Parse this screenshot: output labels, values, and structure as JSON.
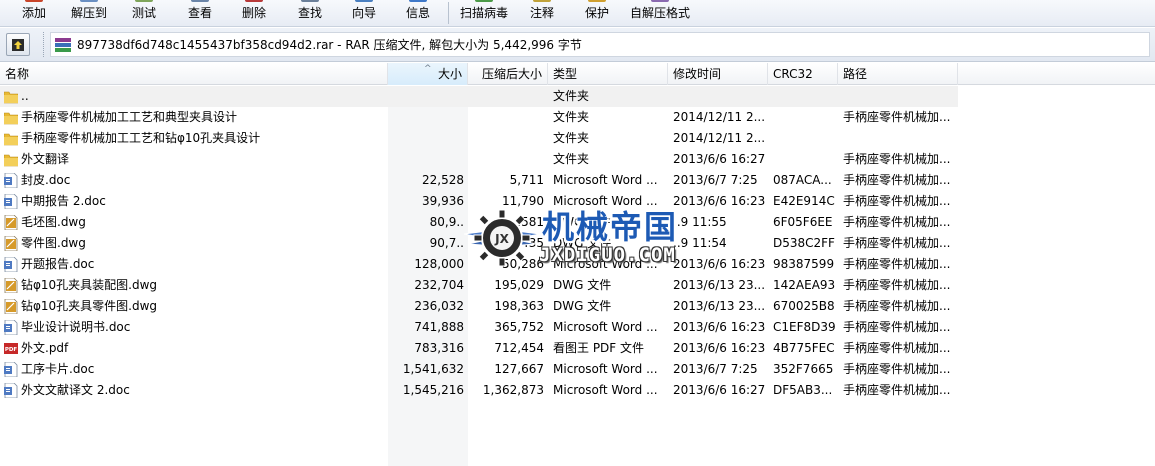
{
  "toolbar": {
    "buttons": [
      {
        "label": "添加",
        "icon": "add-icon",
        "color": "#c8452a"
      },
      {
        "label": "解压到",
        "icon": "extract-to-icon",
        "color": "#6a8fc2"
      },
      {
        "label": "测试",
        "icon": "test-icon",
        "color": "#7fa55a"
      },
      {
        "label": "查看",
        "icon": "view-icon",
        "color": "#6b85a8"
      },
      {
        "label": "删除",
        "icon": "delete-icon",
        "color": "#b83a3a"
      },
      {
        "label": "查找",
        "icon": "find-icon",
        "color": "#6b7f99"
      },
      {
        "label": "向导",
        "icon": "wizard-icon",
        "color": "#4a7fc0"
      },
      {
        "label": "信息",
        "icon": "info-icon",
        "color": "#3f78c8"
      },
      {
        "label": "扫描病毒",
        "icon": "virus-scan-icon",
        "color": "#4b9a48"
      },
      {
        "label": "注释",
        "icon": "comment-icon",
        "color": "#c0a23a"
      },
      {
        "label": "保护",
        "icon": "protect-icon",
        "color": "#d0a030"
      },
      {
        "label": "自解压格式",
        "icon": "sfx-icon",
        "color": "#8a6ab0"
      }
    ]
  },
  "address": {
    "text": "897738df6d748c1455437bf358cd94d2.rar - RAR 压缩文件, 解包大小为 5,442,996 字节"
  },
  "columns": {
    "name": "名称",
    "size": "大小",
    "packed": "压缩后大小",
    "type": "类型",
    "mtime": "修改时间",
    "crc": "CRC32",
    "path": "路径"
  },
  "files": [
    {
      "name": "..",
      "size": "",
      "packed": "",
      "type": "文件夹",
      "mtime": "",
      "crc": "",
      "path": "",
      "icon": "folder-icon"
    },
    {
      "name": "手柄座零件机械加工工艺和典型夹具设计",
      "size": "",
      "packed": "",
      "type": "文件夹",
      "mtime": "2014/12/11 2...",
      "crc": "",
      "path": "手柄座零件机械加...",
      "icon": "folder-icon"
    },
    {
      "name": "手柄座零件机械加工工艺和钻φ10孔夹具设计",
      "size": "",
      "packed": "",
      "type": "文件夹",
      "mtime": "2014/12/11 2...",
      "crc": "",
      "path": "",
      "icon": "folder-icon"
    },
    {
      "name": "外文翻译",
      "size": "",
      "packed": "",
      "type": "文件夹",
      "mtime": "2013/6/6 16:27",
      "crc": "",
      "path": "手柄座零件机械加...",
      "icon": "folder-icon"
    },
    {
      "name": "封皮.doc",
      "size": "22,528",
      "packed": "5,711",
      "type": "Microsoft Word ...",
      "mtime": "2013/6/7 7:25",
      "crc": "087ACA...",
      "path": "手柄座零件机械加...",
      "icon": "doc-icon"
    },
    {
      "name": "中期报告 2.doc",
      "size": "39,936",
      "packed": "11,790",
      "type": "Microsoft Word ...",
      "mtime": "2013/6/6 16:23",
      "crc": "E42E914C",
      "path": "手柄座零件机械加...",
      "icon": "doc-icon"
    },
    {
      "name": "毛坯图.dwg",
      "size": "80,9..",
      "packed": "..581",
      "type": "DWG 文件",
      "mtime": "..9 11:55",
      "crc": "6F05F6EE",
      "path": "手柄座零件机械加...",
      "icon": "dwg-icon"
    },
    {
      "name": "零件图.dwg",
      "size": "90,7..",
      "packed": "..435",
      "type": "DWG 文件",
      "mtime": "..9 11:54",
      "crc": "D538C2FF",
      "path": "手柄座零件机械加...",
      "icon": "dwg-icon"
    },
    {
      "name": "开题报告.doc",
      "size": "128,000",
      "packed": "50,286",
      "type": "Microsoft Word ...",
      "mtime": "2013/6/6 16:23",
      "crc": "98387599",
      "path": "手柄座零件机械加...",
      "icon": "doc-icon"
    },
    {
      "name": "钻φ10孔夹具装配图.dwg",
      "size": "232,704",
      "packed": "195,029",
      "type": "DWG 文件",
      "mtime": "2013/6/13 23...",
      "crc": "142AEA93",
      "path": "手柄座零件机械加...",
      "icon": "dwg-icon"
    },
    {
      "name": "钻φ10孔夹具零件图.dwg",
      "size": "236,032",
      "packed": "198,363",
      "type": "DWG 文件",
      "mtime": "2013/6/13 23...",
      "crc": "670025B8",
      "path": "手柄座零件机械加...",
      "icon": "dwg-icon"
    },
    {
      "name": "毕业设计说明书.doc",
      "size": "741,888",
      "packed": "365,752",
      "type": "Microsoft Word ...",
      "mtime": "2013/6/6 16:23",
      "crc": "C1EF8D39",
      "path": "手柄座零件机械加...",
      "icon": "doc-icon"
    },
    {
      "name": "外文.pdf",
      "size": "783,316",
      "packed": "712,454",
      "type": "看图王 PDF 文件",
      "mtime": "2013/6/6 16:23",
      "crc": "4B775FEC",
      "path": "手柄座零件机械加...",
      "icon": "pdf-icon"
    },
    {
      "name": "工序卡片.doc",
      "size": "1,541,632",
      "packed": "127,667",
      "type": "Microsoft Word ...",
      "mtime": "2013/6/7 7:25",
      "crc": "352F7665",
      "path": "手柄座零件机械加...",
      "icon": "doc-icon"
    },
    {
      "name": "外文文献译文 2.doc",
      "size": "1,545,216",
      "packed": "1,362,873",
      "type": "Microsoft Word ...",
      "mtime": "2013/6/6 16:27",
      "crc": "DF5AB3...",
      "path": "手柄座零件机械加...",
      "icon": "doc-icon"
    }
  ],
  "watermark": {
    "title": "机械帝国",
    "subtitle": "JXDIGUO.COM"
  },
  "colors": {
    "folder": "#e8b933",
    "doc": "#4f7ac2",
    "dwg": "#d69a2a",
    "pdf": "#c62828",
    "watermark_blue": "#1d5ab4"
  }
}
